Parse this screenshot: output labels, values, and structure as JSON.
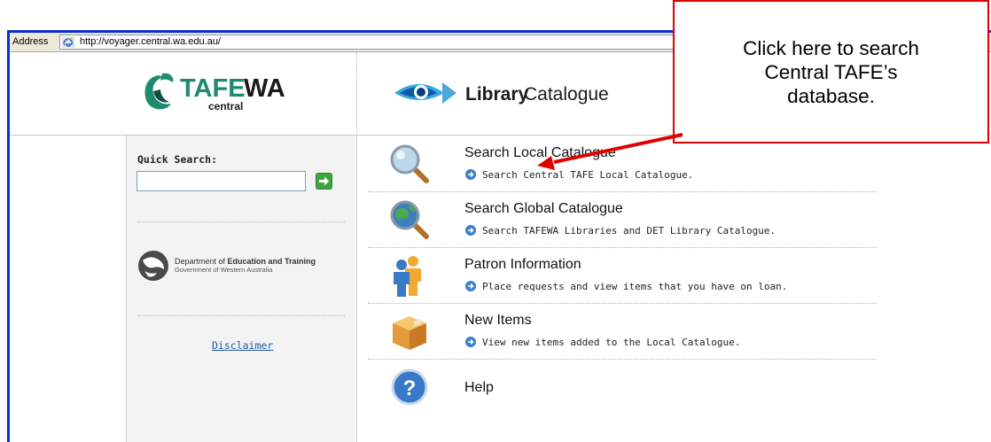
{
  "browser": {
    "address_label": "Address",
    "url": "http://voyager.central.wa.edu.au/"
  },
  "header": {
    "tafe_logo_main": "TAFE",
    "tafe_logo_accent": "WA",
    "tafe_logo_sub": "central",
    "library_logo_bold": "Library",
    "library_logo_rest": "Catalogue"
  },
  "sidebar": {
    "quick_search_label": "Quick Search:",
    "quick_search_value": "",
    "dept_line1_pre": "Department of ",
    "dept_line1_bold": "Education and Training",
    "dept_line2": "Government of Western Australia",
    "disclaimer": "Disclaimer"
  },
  "menu": [
    {
      "title": "Search Local Catalogue",
      "desc": "Search Central TAFE Local Catalogue.",
      "icon": "magnifier-icon"
    },
    {
      "title": "Search Global Catalogue",
      "desc": "Search TAFEWA Libraries and DET Library Catalogue.",
      "icon": "globe-search-icon"
    },
    {
      "title": "Patron Information",
      "desc": "Place requests and view items that you have on loan.",
      "icon": "patrons-icon"
    },
    {
      "title": "New Items",
      "desc": "View new items added to the Local Catalogue.",
      "icon": "box-icon"
    },
    {
      "title": "Help",
      "desc": "",
      "icon": "help-icon"
    }
  ],
  "callout": {
    "text": "Click here to search Central TAFE’s database."
  },
  "colors": {
    "window_border": "#0a2fd8",
    "callout_border": "#e00000",
    "link": "#1d5aa8",
    "bullet": "#3b7fc8",
    "go_button": "#3fa63f"
  }
}
